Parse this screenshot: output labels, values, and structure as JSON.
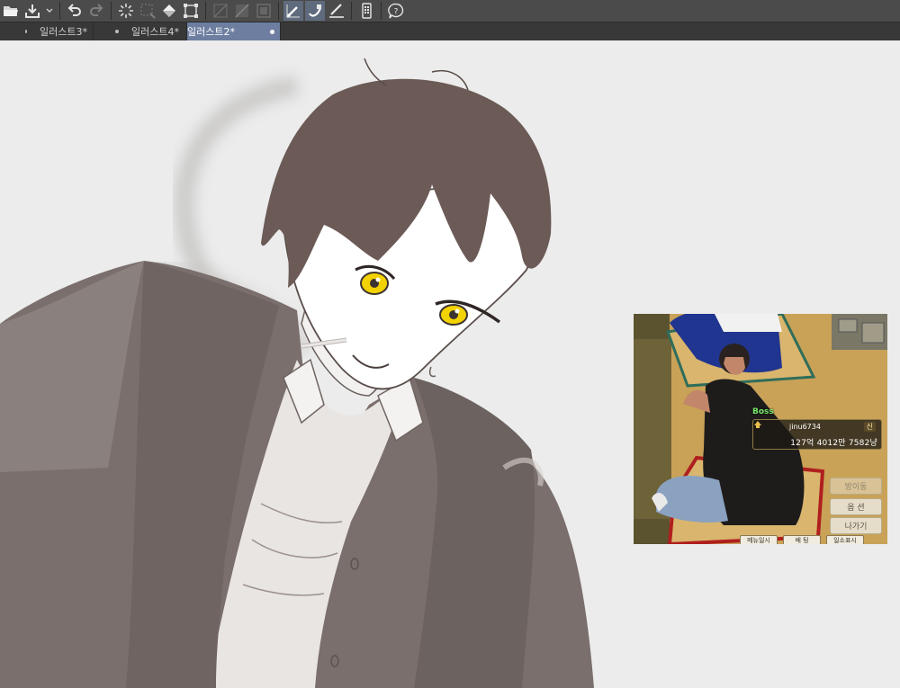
{
  "toolbar": {
    "icons": [
      "folder-open-icon",
      "save-icon",
      "dropdown-arrow-icon",
      "undo-icon",
      "redo-icon",
      "loading-icon",
      "clear-selection-icon",
      "fill-icon",
      "transform-icon",
      "snap-ruler-icon",
      "snap-special-ruler-icon",
      "snap-grid-icon",
      "pen-icon",
      "eraser-icon",
      "ruler-pen-icon",
      "smartphone-icon",
      "help-icon"
    ]
  },
  "tabs": [
    {
      "label": "일러스트3*",
      "active": false
    },
    {
      "label": "일러스트4*",
      "active": false
    },
    {
      "label": "일러스트2*",
      "active": true
    }
  ],
  "reference": {
    "boss_label": "Boss",
    "player_name": "jinu6734",
    "player_rank": "신",
    "player_money": "127억 4012만 7582냥",
    "buttons": [
      "방이동",
      "옵 션",
      "나가기"
    ],
    "bottom_tabs": [
      "메뉴일시",
      "배 팅",
      "일소표시"
    ]
  }
}
